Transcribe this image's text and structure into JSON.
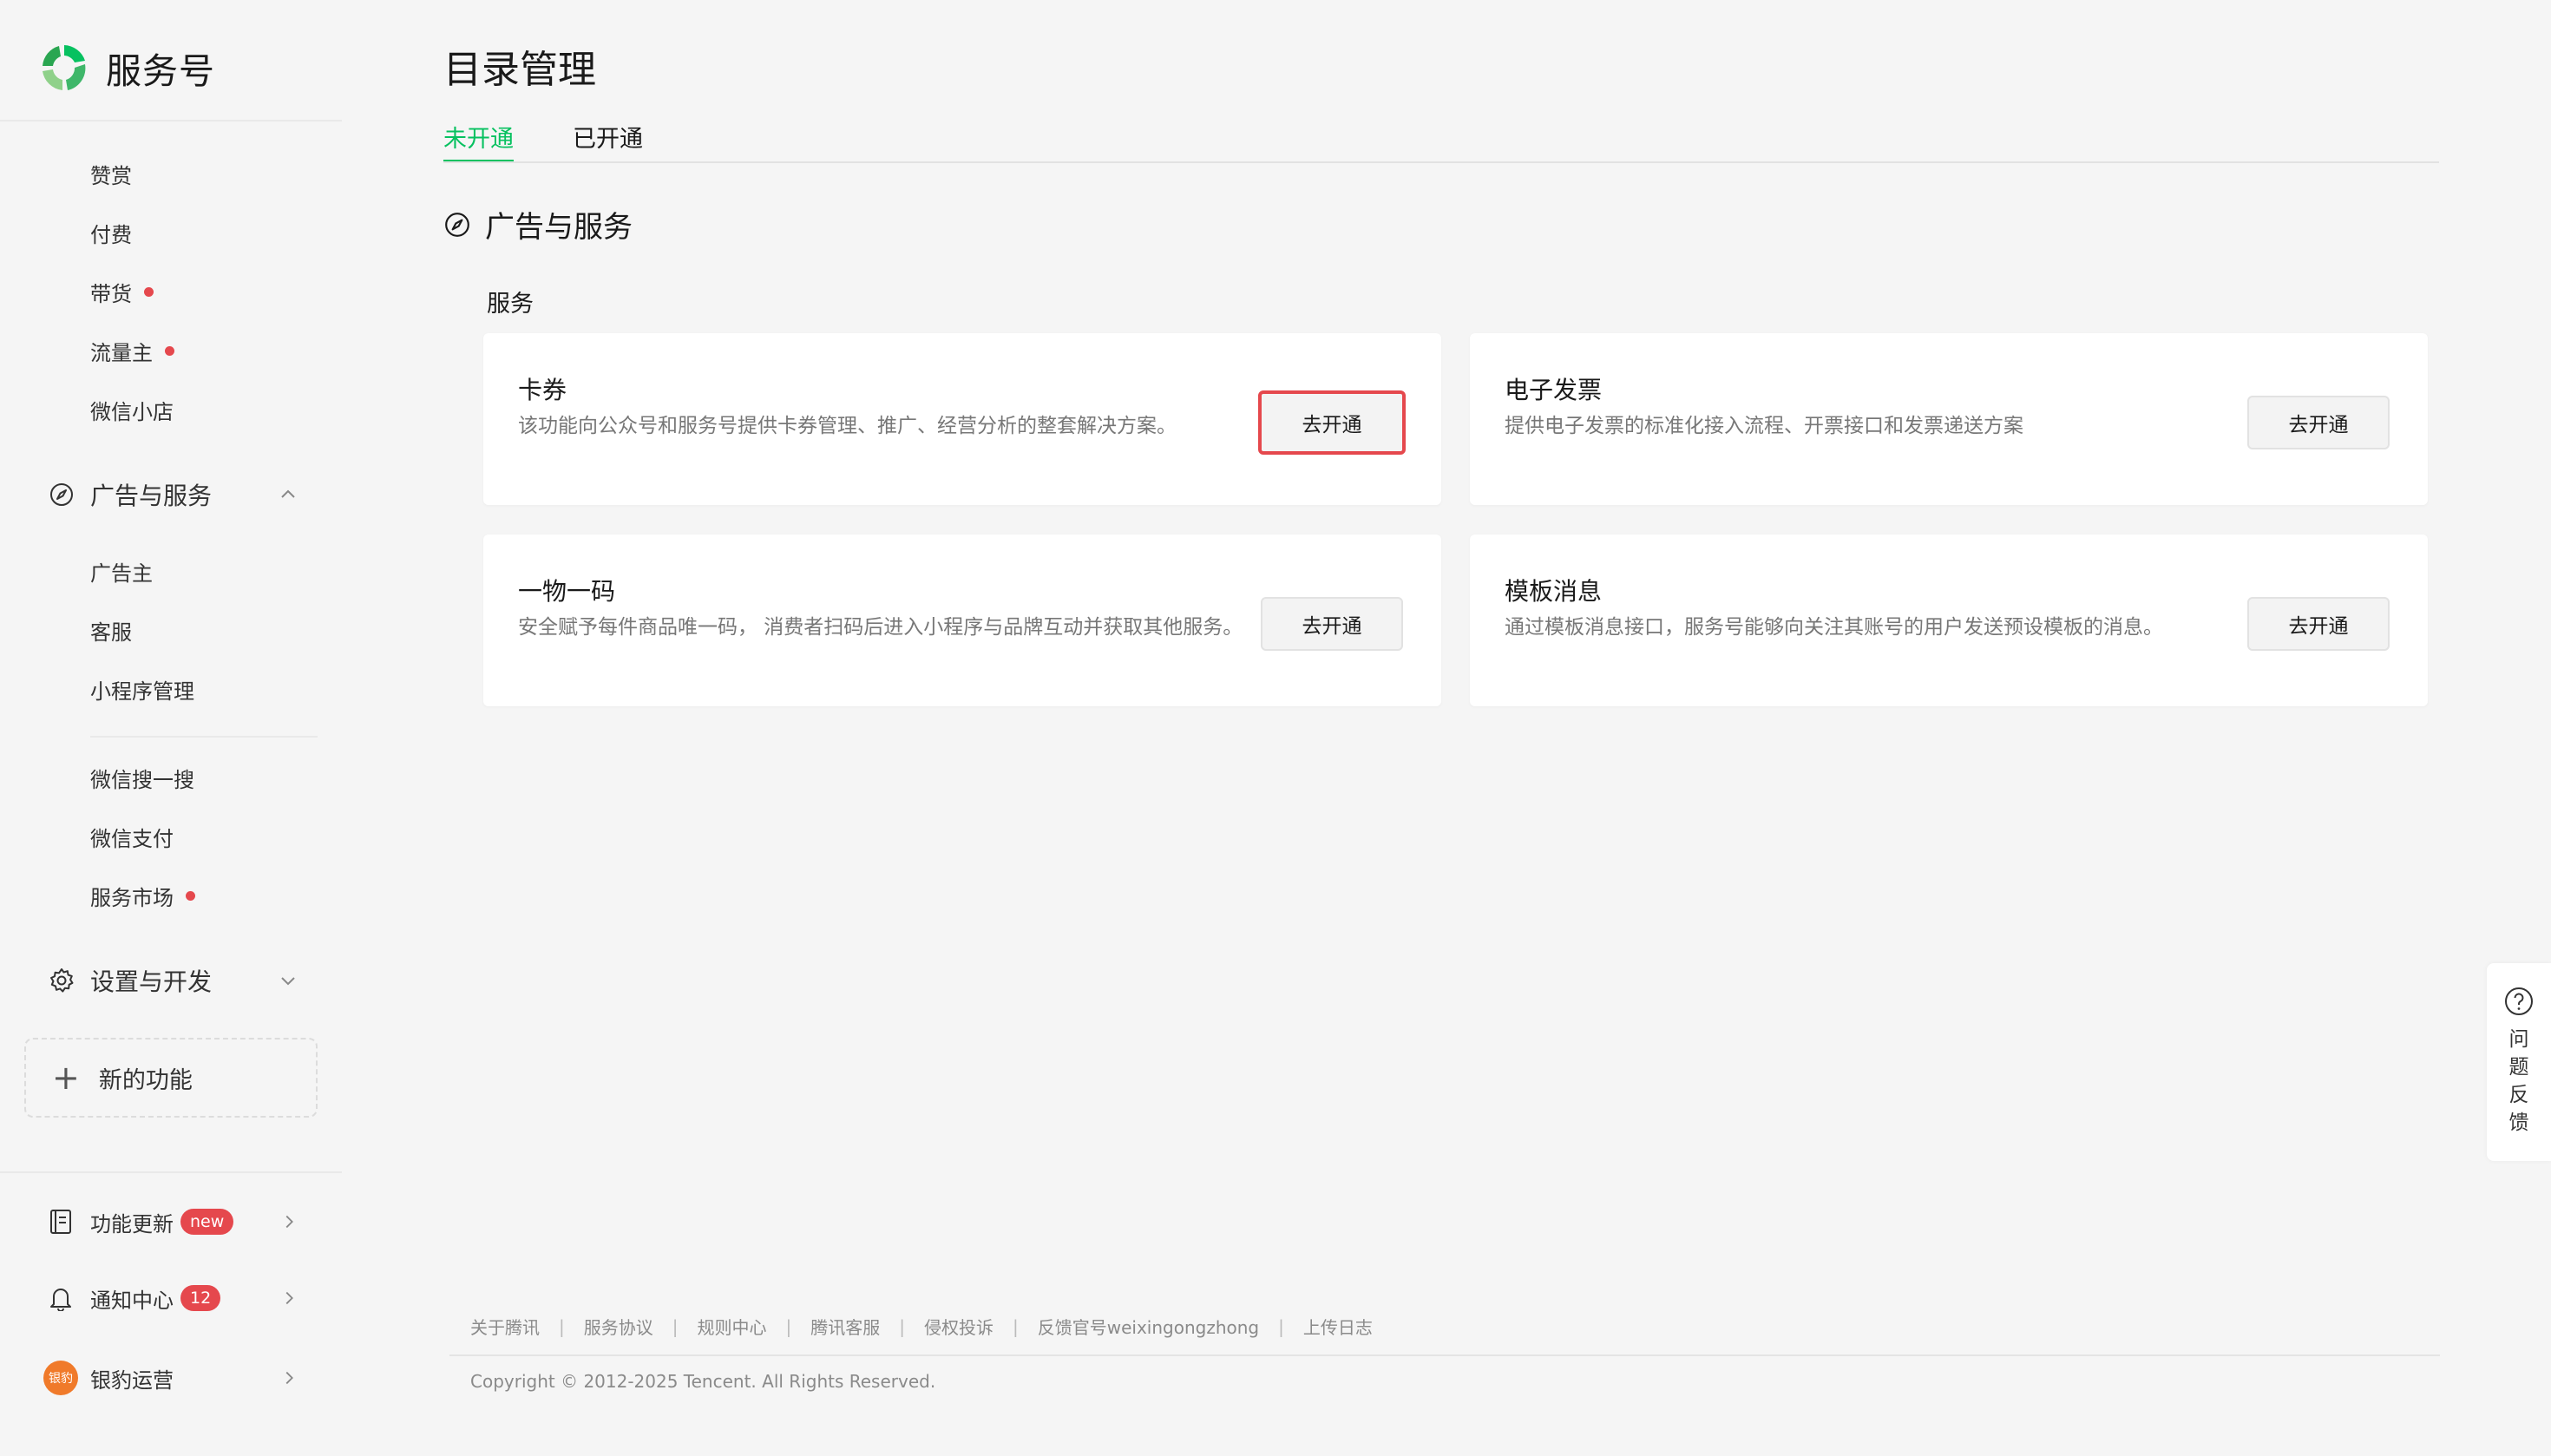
{
  "app": {
    "name": "服务号"
  },
  "sidebar": {
    "items_top": [
      {
        "label": "赞赏",
        "dot": false
      },
      {
        "label": "付费",
        "dot": false
      },
      {
        "label": "带货",
        "dot": true
      },
      {
        "label": "流量主",
        "dot": true
      },
      {
        "label": "微信小店",
        "dot": false
      }
    ],
    "group_ads": {
      "label": "广告与服务",
      "expanded": true
    },
    "items_ads": [
      {
        "label": "广告主"
      },
      {
        "label": "客服"
      },
      {
        "label": "小程序管理"
      }
    ],
    "items_more": [
      {
        "label": "微信搜一搜",
        "dot": false
      },
      {
        "label": "微信支付",
        "dot": false
      },
      {
        "label": "服务市场",
        "dot": true
      }
    ],
    "group_settings": {
      "label": "设置与开发",
      "expanded": false
    },
    "new_feature": {
      "label": "新的功能"
    },
    "bottom": {
      "updates": {
        "label": "功能更新",
        "badge": "new"
      },
      "notifications": {
        "label": "通知中心",
        "badge": "12"
      },
      "account": {
        "label": "银豹运营",
        "avatar_text": "银豹"
      }
    }
  },
  "main": {
    "title": "目录管理",
    "tabs": [
      {
        "label": "未开通",
        "active": true
      },
      {
        "label": "已开通",
        "active": false
      }
    ],
    "section": {
      "title": "广告与服务"
    },
    "subsection": {
      "title": "服务"
    },
    "cards": [
      {
        "title": "卡券",
        "desc": "该功能向公众号和服务号提供卡券管理、推广、经营分析的整套解决方案。",
        "button": "去开通",
        "highlighted": true
      },
      {
        "title": "电子发票",
        "desc": "提供电子发票的标准化接入流程、开票接口和发票递送方案",
        "button": "去开通",
        "highlighted": false
      },
      {
        "title": "一物一码",
        "desc": "安全赋予每件商品唯一码， 消费者扫码后进入小程序与品牌互动并获取其他服务。",
        "button": "去开通",
        "highlighted": false
      },
      {
        "title": "模板消息",
        "desc": "通过模板消息接口，服务号能够向关注其账号的用户发送预设模板的消息。",
        "button": "去开通",
        "highlighted": false
      }
    ]
  },
  "footer": {
    "links": [
      "关于腾讯",
      "服务协议",
      "规则中心",
      "腾讯客服",
      "侵权投诉",
      "反馈官号weixingongzhong",
      "上传日志"
    ],
    "separator": "|",
    "copyright": "Copyright © 2012-2025 Tencent. All Rights Reserved."
  },
  "feedback": {
    "label": "问题反馈"
  },
  "colors": {
    "accent": "#07c160",
    "dot": "#e5484d",
    "highlight_border": "#e5484d"
  },
  "icons": {
    "logo": "wechat-service-logo",
    "ads_group": "compass-icon",
    "settings_group": "gear-icon",
    "updates": "book-icon",
    "notifications": "bell-icon",
    "feedback": "question-circle-icon"
  }
}
